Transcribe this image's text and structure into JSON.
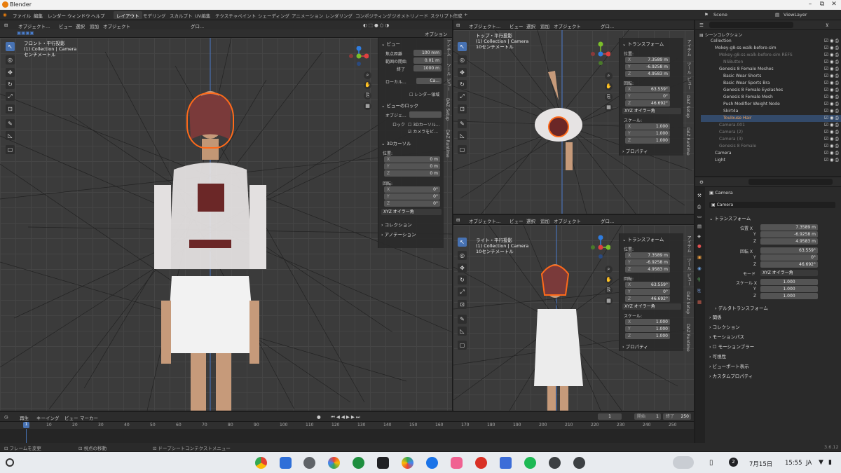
{
  "window": {
    "title": "Blender",
    "min": "–",
    "max": "⧉",
    "close": "✕"
  },
  "menu": [
    "ファイル",
    "編集",
    "レンダー",
    "ウィンドウ",
    "ヘルプ"
  ],
  "workspaces": [
    "レイアウト",
    "モデリング",
    "スカルプト",
    "UV編集",
    "テクスチャペイント",
    "シェーディング",
    "アニメーション",
    "レンダリング",
    "コンポジティング",
    "ジオメトリノード",
    "スクリプト作成",
    "+"
  ],
  "scene": {
    "label": "Scene",
    "viewlayer": "ViewLayer"
  },
  "vp_header": {
    "mode": "オブジェクト...",
    "items": [
      "ビュー",
      "選択",
      "追加",
      "オブジェクト"
    ],
    "orient": "グロ...",
    "options": "オプション"
  },
  "vp_main": {
    "line1": "フロント・平行投影",
    "line2": "(1) Collection | Camera",
    "line3": "センチメートル"
  },
  "vp_top": {
    "line1": "トップ・平行投影",
    "line2": "(1) Collection | Camera",
    "line3": "10センチメートル"
  },
  "vp_right": {
    "line1": "ライト・平行投影",
    "line2": "(1) Collection | Camera",
    "line3": "10センチメートル"
  },
  "npanel_main": {
    "view_title": "ビュー",
    "focal_label": "焦点距離",
    "focal": "100 mm",
    "clip_start_label": "範囲の開始",
    "clip_start": "0.01 m",
    "clip_end_label": "終了",
    "clip_end": "1000 m",
    "local_camera": "ローカル...",
    "camera_field": "Ca...",
    "render_region": "レンダー領域",
    "lock_title": "ビューのロック",
    "lock_obj_label": "オブジェ...",
    "lock_label": "ロック",
    "lock_3d": "3Dカーソル...",
    "lock_cam": "カメラをビ...",
    "cursor_title": "3Dカーソル",
    "pos_label": "位置:",
    "x": "0 m",
    "y": "0 m",
    "z": "0 m",
    "rot_label": "回転:",
    "rx": "0°",
    "ry": "0°",
    "rz": "0°",
    "rot_mode": "XYZ オイラー角",
    "collection": "コレクション",
    "annotation": "アノテーション",
    "tabs": [
      "アイテム",
      "ツール",
      "ビュー",
      "DAZ Setup",
      "DAZ Runtime"
    ]
  },
  "transform": {
    "title": "トランスフォーム",
    "pos_label": "位置:",
    "rot_label": "回転:",
    "scale_label": "スケール:",
    "x": "7.3589 m",
    "y": "-6.9258 m",
    "z": "4.9583 m",
    "rx": "63.559°",
    "ry": "0°",
    "rz": "46.692°",
    "rot_mode": "XYZ オイラー角",
    "sx": "1.000",
    "sy": "1.000",
    "sz": "1.000",
    "props": "プロパティ",
    "axis": [
      "X",
      "Y",
      "Z"
    ]
  },
  "outliner": {
    "root": "シーンコレクション",
    "items": [
      {
        "label": "Collection",
        "cls": ""
      },
      {
        "label": "Mokey-g8-ss-walk-before-sim",
        "cls": ""
      },
      {
        "label": "Mokey-g8-ss-walk-before-sim REFS",
        "cls": "dim"
      },
      {
        "label": "NSButton",
        "cls": "dim"
      },
      {
        "label": "Genesis 8 Female Meshes",
        "cls": ""
      },
      {
        "label": "Basic Wear Shorts",
        "cls": ""
      },
      {
        "label": "Basic Wear Sports Bra",
        "cls": ""
      },
      {
        "label": "Genesis 8 Female Eyelashes",
        "cls": ""
      },
      {
        "label": "Genesis 8 Female Mesh",
        "cls": ""
      },
      {
        "label": "Push Modifier Weight Node",
        "cls": ""
      },
      {
        "label": "Skirt4a",
        "cls": ""
      },
      {
        "label": "Toulouse Hair",
        "cls": "sel"
      },
      {
        "label": "Camera.001",
        "cls": "dim"
      },
      {
        "label": "Camera (2)",
        "cls": "dim"
      },
      {
        "label": "Camera (3)",
        "cls": "dim"
      },
      {
        "label": "Genesis 8 Female",
        "cls": "dim"
      },
      {
        "label": "Camera",
        "cls": ""
      },
      {
        "label": "Light",
        "cls": ""
      }
    ]
  },
  "properties": {
    "obj": "Camera",
    "name": "Camera",
    "section": "トランスフォーム",
    "pos": "位置 X",
    "x": "7.3589 m",
    "y": "-6.9258 m",
    "z": "4.9583 m",
    "rot": "回転 X",
    "rx": "63.559°",
    "ry": "0°",
    "rz": "46.692°",
    "mode_label": "モード",
    "mode": "XYZ オイラー角",
    "scale": "スケール X",
    "sx": "1.000",
    "sy": "1.000",
    "sz": "1.000",
    "sections": [
      "デルタトランスフォーム",
      "関係",
      "コレクション",
      "モーションパス",
      "モーションブラー",
      "可視性",
      "ビューポート表示",
      "カスタムプロパティ"
    ]
  },
  "timeline": {
    "menu": [
      "再生",
      "キーイング",
      "ビュー",
      "マーカー"
    ],
    "current": "1",
    "start_label": "開始",
    "start": "1",
    "end_label": "終了",
    "end": "250",
    "ticks": [
      "10",
      "20",
      "30",
      "40",
      "50",
      "60",
      "70",
      "80",
      "90",
      "100",
      "110",
      "120",
      "130",
      "140",
      "150",
      "160",
      "170",
      "180",
      "190",
      "200",
      "210",
      "220",
      "230",
      "240",
      "250"
    ],
    "frame_marker": "1"
  },
  "status": {
    "s1": "フレームを変更",
    "s2": "視点の移動",
    "s3": "ドープシートコンテクストメニュー",
    "version": "3.6.12"
  },
  "taskbar": {
    "date": "7月15日",
    "time": "15:55",
    "lang": "JA",
    "badge": "2"
  },
  "colors": {
    "accent": "#4772b3",
    "selected": "#ff6a1a",
    "bg": "#3b3b3b"
  }
}
